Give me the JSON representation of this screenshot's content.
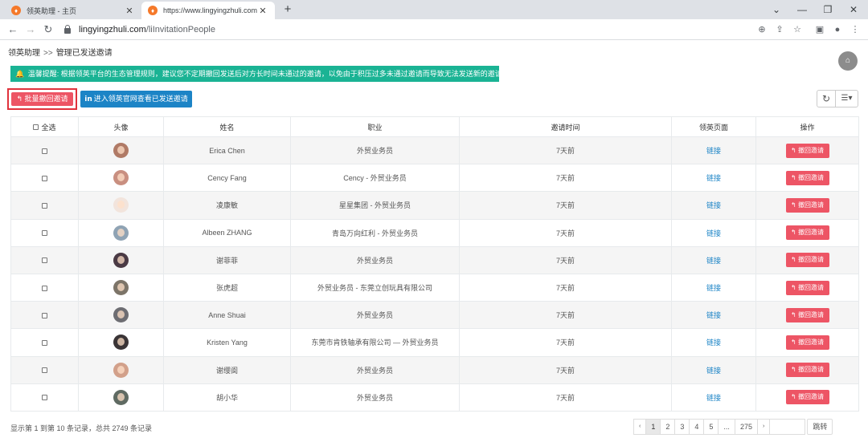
{
  "browser": {
    "tabs": [
      {
        "title": "领英助理 - 主页",
        "active": false
      },
      {
        "title": "https://www.lingyingzhuli.com",
        "active": true
      }
    ],
    "url_host": "lingyingzhuli.com",
    "url_path": "/liInvitationPeople"
  },
  "breadcrumb": {
    "root": "领英助理",
    "separator": ">>",
    "current": "管理已发送邀请"
  },
  "notice": {
    "label": "温馨提醒:",
    "text": "根据领英平台的生态管理规则，建议您不定期撤回发送后对方长时间未通过的邀请，以免由于积压过多未通过邀请而导致无法发送新的邀请"
  },
  "toolbar": {
    "batch_revoke_label": "批量撤回邀请",
    "linkedin_label": "进入领英官网查看已发送邀请"
  },
  "table": {
    "columns": [
      "全选",
      "头像",
      "姓名",
      "职业",
      "邀请时间",
      "领英页面",
      "操作"
    ],
    "rows": [
      {
        "name": "Erica Chen",
        "job": "外贸业务员",
        "time": "7天前",
        "page": "链接",
        "action": "撤回邀请",
        "avatar": "#b07a66"
      },
      {
        "name": "Cency Fang",
        "job": "Cency - 外贸业务员",
        "time": "7天前",
        "page": "链接",
        "action": "撤回邀请",
        "avatar": "#c98f80"
      },
      {
        "name": "凌康敏",
        "job": "星星集团 - 外贸业务员",
        "time": "7天前",
        "page": "链接",
        "action": "撤回邀请",
        "avatar": "#f2e4dc"
      },
      {
        "name": "Albeen ZHANG",
        "job": "青岛万向红利 - 外贸业务员",
        "time": "7天前",
        "page": "链接",
        "action": "撤回邀请",
        "avatar": "#8fa3b4"
      },
      {
        "name": "谢菲菲",
        "job": "外贸业务员",
        "time": "7天前",
        "page": "链接",
        "action": "撤回邀请",
        "avatar": "#4a3a44"
      },
      {
        "name": "张虎超",
        "job": "外贸业务员 - 东莞立创玩具有限公司",
        "time": "7天前",
        "page": "链接",
        "action": "撤回邀请",
        "avatar": "#7c7468"
      },
      {
        "name": "Anne Shuai",
        "job": "外贸业务员",
        "time": "7天前",
        "page": "链接",
        "action": "撤回邀请",
        "avatar": "#6d6d72"
      },
      {
        "name": "Kristen Yang",
        "job": "东莞市肯铁轴承有限公司 — 外贸业务员",
        "time": "7天前",
        "page": "链接",
        "action": "撤回邀请",
        "avatar": "#3a3436"
      },
      {
        "name": "谢缨阆",
        "job": "外贸业务员",
        "time": "7天前",
        "page": "链接",
        "action": "撤回邀请",
        "avatar": "#d2a08a"
      },
      {
        "name": "胡小华",
        "job": "外贸业务员",
        "time": "7天前",
        "page": "链接",
        "action": "撤回邀请",
        "avatar": "#5f6a62"
      }
    ]
  },
  "footer": {
    "summary": "显示第 1 到第 10 条记录，总共 2749 条记录",
    "pages": [
      "‹",
      "1",
      "2",
      "3",
      "4",
      "5",
      "...",
      "275",
      "›"
    ],
    "current_page": "1",
    "go_label": "跳转"
  }
}
